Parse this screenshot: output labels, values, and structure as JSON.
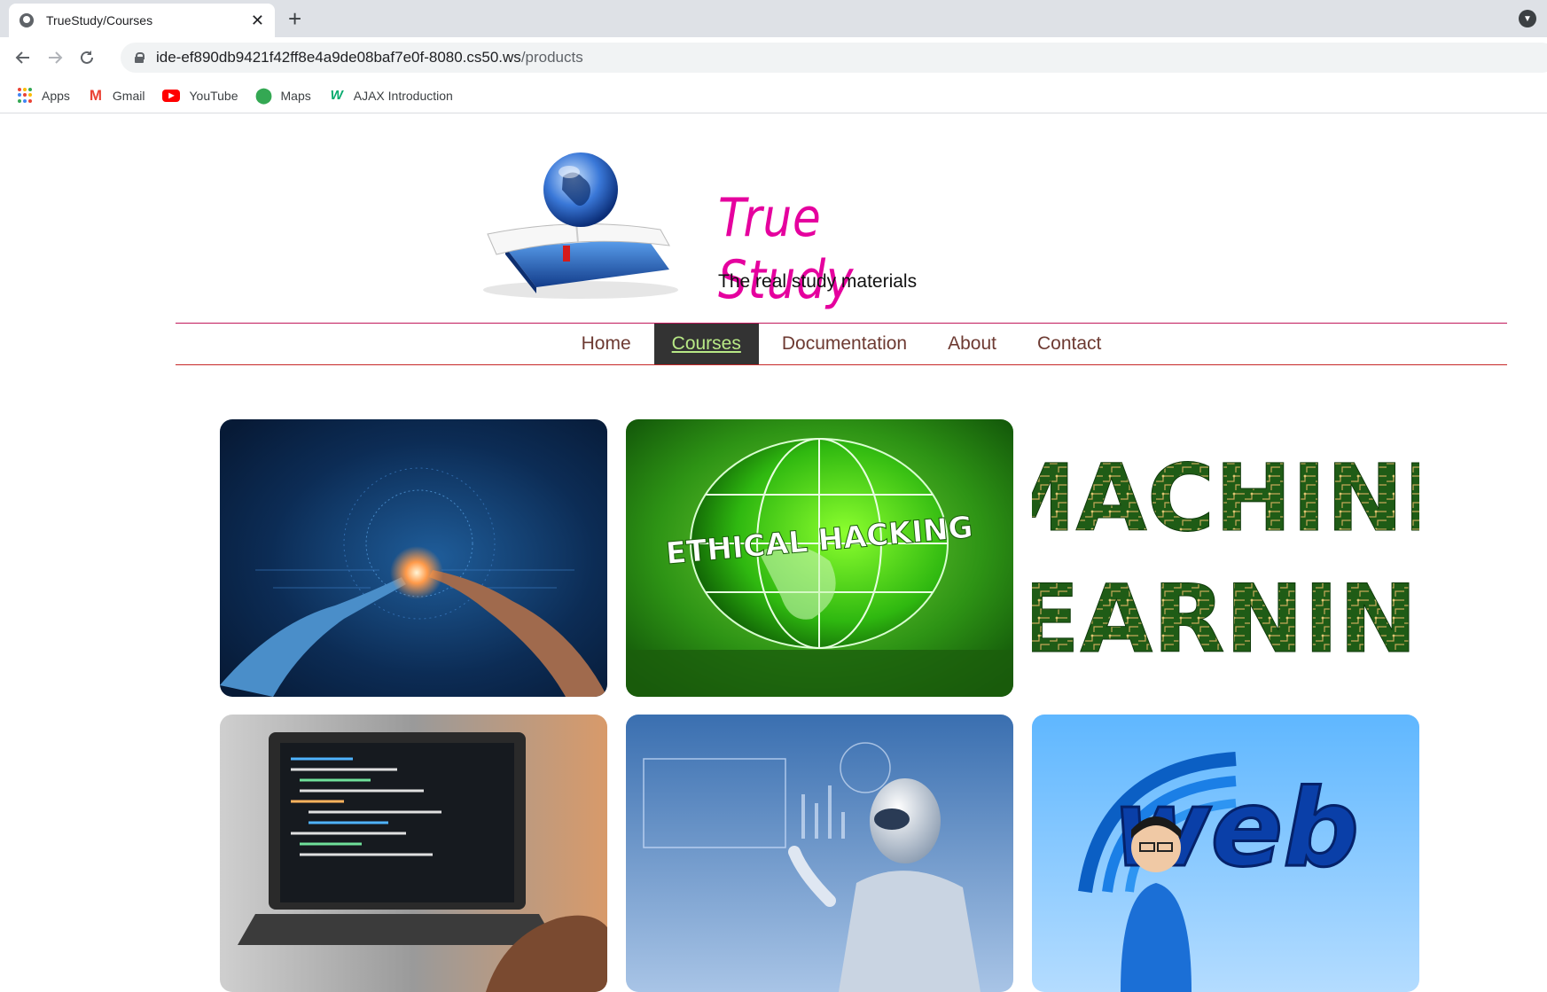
{
  "browser": {
    "tab_title": "TrueStudy/Courses",
    "url_host": "ide-ef890db9421f42ff8e4a9de08baf7e0f-8080.cs50.ws",
    "url_path": "/products",
    "bookmarks": [
      {
        "label": "Apps",
        "icon": "apps-grid-icon"
      },
      {
        "label": "Gmail",
        "icon": "gmail-icon"
      },
      {
        "label": "YouTube",
        "icon": "youtube-icon"
      },
      {
        "label": "Maps",
        "icon": "maps-icon"
      },
      {
        "label": "AJAX Introduction",
        "icon": "w3schools-icon"
      }
    ]
  },
  "site": {
    "title": "True Study",
    "tagline": "The real study materials",
    "nav": [
      {
        "label": "Home",
        "active": false
      },
      {
        "label": "Courses",
        "active": true
      },
      {
        "label": "Documentation",
        "active": false
      },
      {
        "label": "About",
        "active": false
      },
      {
        "label": "Contact",
        "active": false
      }
    ],
    "brand_color": "#e5009e",
    "nav_active_bg": "#333333",
    "nav_active_text": "#b8e986"
  },
  "courses": {
    "ethical_hacking_text": "ETHICAL HACKING",
    "machine_learning_line1": "MACHINE",
    "machine_learning_line2": "LEARNING",
    "web_design_text": "web"
  }
}
